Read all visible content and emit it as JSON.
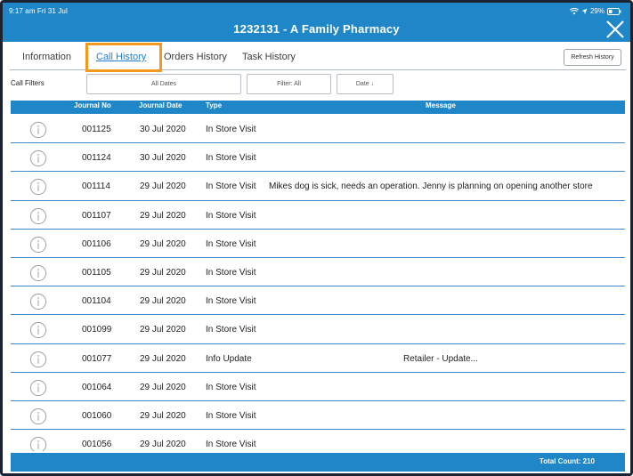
{
  "status_bar": {
    "time": "9:17 am   Fri 31 Jul",
    "battery": "29%"
  },
  "header": {
    "title": "1232131 - A Family Pharmacy"
  },
  "tabs": [
    {
      "label": "Information",
      "active": false
    },
    {
      "label": "Call History",
      "active": true
    },
    {
      "label": "Orders History",
      "active": false
    },
    {
      "label": "Task History",
      "active": false
    }
  ],
  "refresh_label": "Refresh History",
  "filters": {
    "label": "Call Filters",
    "date_filter": "All Dates",
    "type_filter": "Filter: All",
    "sort": "Date ↓"
  },
  "table": {
    "columns": [
      "Journal No",
      "Journal Date",
      "Type",
      "Message"
    ],
    "rows": [
      {
        "journal_no": "001125",
        "date": "30 Jul 2020",
        "type": "In Store Visit",
        "message": ""
      },
      {
        "journal_no": "001124",
        "date": "30 Jul 2020",
        "type": "In Store Visit",
        "message": ""
      },
      {
        "journal_no": "001114",
        "date": "29 Jul 2020",
        "type": "In Store Visit",
        "message": "Mikes dog is sick, needs an operation.   Jenny is planning on opening another store"
      },
      {
        "journal_no": "001107",
        "date": "29 Jul 2020",
        "type": "In Store Visit",
        "message": ""
      },
      {
        "journal_no": "001106",
        "date": "29 Jul 2020",
        "type": "In Store Visit",
        "message": ""
      },
      {
        "journal_no": "001105",
        "date": "29 Jul 2020",
        "type": "In Store Visit",
        "message": ""
      },
      {
        "journal_no": "001104",
        "date": "29 Jul 2020",
        "type": "In Store Visit",
        "message": ""
      },
      {
        "journal_no": "001099",
        "date": "29 Jul 2020",
        "type": "In Store Visit",
        "message": ""
      },
      {
        "journal_no": "001077",
        "date": "29 Jul 2020",
        "type": "Info Update",
        "message": "Retailer - Update..."
      },
      {
        "journal_no": "001064",
        "date": "29 Jul 2020",
        "type": "In Store Visit",
        "message": ""
      },
      {
        "journal_no": "001060",
        "date": "29 Jul 2020",
        "type": "In Store Visit",
        "message": ""
      },
      {
        "journal_no": "001056",
        "date": "29 Jul 2020",
        "type": "In Store Visit",
        "message": ""
      }
    ]
  },
  "footer": {
    "total": "Total Count: 210"
  },
  "colors": {
    "primary": "#1f86c8",
    "tab_active": "#1f7fd6",
    "highlight": "#f39a1e"
  }
}
